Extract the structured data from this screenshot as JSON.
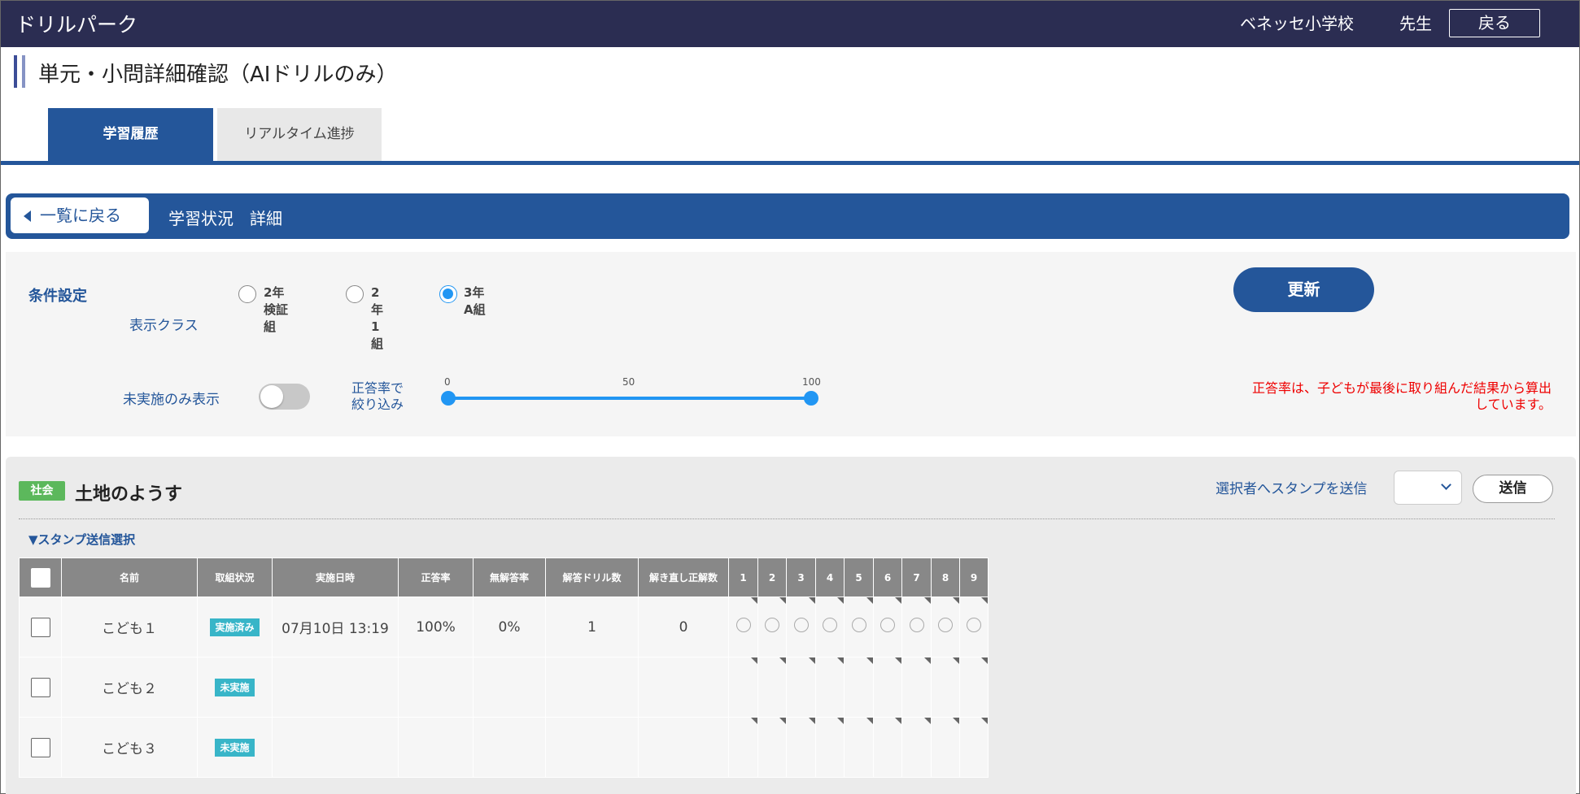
{
  "header": {
    "app_title": "ドリルパーク",
    "school": "ベネッセ小学校",
    "user": "先生",
    "back_label": "戻る"
  },
  "page": {
    "title": "単元・小問詳細確認（AIドリルのみ）"
  },
  "tabs": [
    {
      "label": "学習履歴",
      "active": true
    },
    {
      "label": "リアルタイム進捗",
      "active": false
    }
  ],
  "detail": {
    "back_to_list": "一覧に戻る",
    "title": "学習状況　詳細"
  },
  "conditions": {
    "label": "条件設定",
    "class_label": "表示クラス",
    "classes": [
      {
        "label": "2年検証組",
        "checked": false
      },
      {
        "label": "2年1組",
        "checked": false
      },
      {
        "label": "3年A組",
        "checked": true
      }
    ],
    "update_label": "更新",
    "unimplemented_label": "未実施のみ表示",
    "unimplemented_on": false,
    "filter_label_1": "正答率で",
    "filter_label_2": "絞り込み",
    "range_min": 0,
    "range_mid": 50,
    "range_max": 100,
    "range_low": 0,
    "range_high": 100,
    "note_1": "正答率は、子どもが最後に取り組んだ結果から算出",
    "note_2": "しています。"
  },
  "subject": {
    "badge": "社会",
    "badge_color": "#5cb85c",
    "unit": "土地のようす",
    "stamp_label": "選択者へスタンプを送信",
    "send_label": "送信",
    "stamp_toggle": "▼スタンプ送信選択"
  },
  "table": {
    "headers": [
      "名前",
      "取組状況",
      "実施日時",
      "正答率",
      "無解答率",
      "解答ドリル数",
      "解き直し正解数",
      "1",
      "2",
      "3",
      "4",
      "5",
      "6",
      "7",
      "8",
      "9"
    ],
    "rows": [
      {
        "name": "こども１",
        "status": "実施済み",
        "datetime": "07月10日 13:19",
        "correct_rate": "100%",
        "no_answer_rate": "0%",
        "drills": "1",
        "redo_correct": "0",
        "has_marks": true
      },
      {
        "name": "こども２",
        "status": "未実施",
        "datetime": "",
        "correct_rate": "",
        "no_answer_rate": "",
        "drills": "",
        "redo_correct": "",
        "has_marks": false
      },
      {
        "name": "こども３",
        "status": "未実施",
        "datetime": "",
        "correct_rate": "",
        "no_answer_rate": "",
        "drills": "",
        "redo_correct": "",
        "has_marks": false
      }
    ]
  },
  "colors": {
    "topbar": "#2b2d52",
    "primary": "#24569a",
    "status": "#38b5c8",
    "note": "#e00000"
  }
}
